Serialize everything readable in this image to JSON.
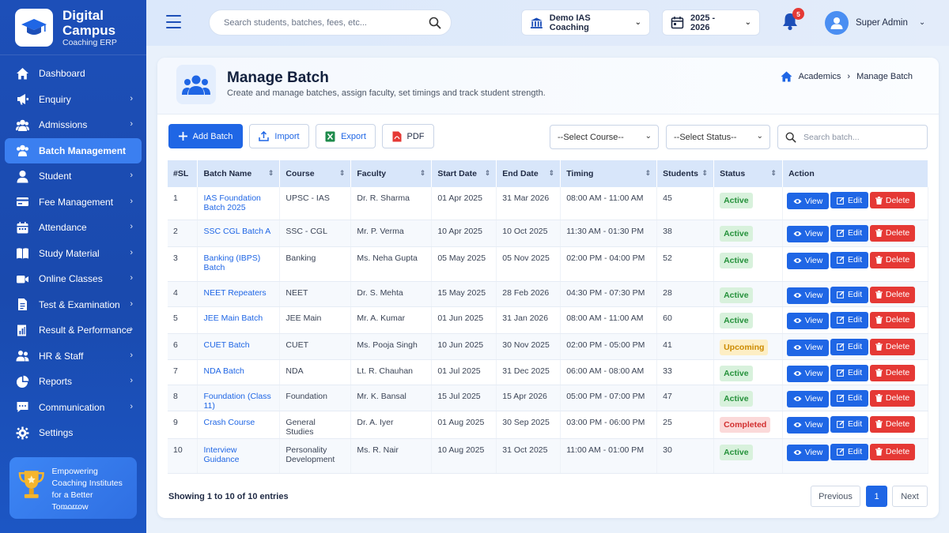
{
  "brand": {
    "title": "Digital Campus",
    "subtitle": "Coaching ERP"
  },
  "sidebar": {
    "items": [
      {
        "label": "Dashboard",
        "icon": "home-icon",
        "chevron": false
      },
      {
        "label": "Enquiry",
        "icon": "megaphone-icon",
        "chevron": true
      },
      {
        "label": "Admissions",
        "icon": "users-icon",
        "chevron": true
      },
      {
        "label": "Batch Management",
        "icon": "batch-icon",
        "chevron": false,
        "active": true
      },
      {
        "label": "Student",
        "icon": "student-icon",
        "chevron": true
      },
      {
        "label": "Fee Management",
        "icon": "card-icon",
        "chevron": true
      },
      {
        "label": "Attendance",
        "icon": "calendar-icon",
        "chevron": true
      },
      {
        "label": "Study Material",
        "icon": "book-icon",
        "chevron": true
      },
      {
        "label": "Online Classes",
        "icon": "video-icon",
        "chevron": true
      },
      {
        "label": "Test & Examination",
        "icon": "document-icon",
        "chevron": true
      },
      {
        "label": "Result & Performance",
        "icon": "chart-icon",
        "chevron": true
      },
      {
        "label": "HR & Staff",
        "icon": "staff-icon",
        "chevron": true
      },
      {
        "label": "Reports",
        "icon": "pie-icon",
        "chevron": true
      },
      {
        "label": "Communication",
        "icon": "chat-icon",
        "chevron": true
      },
      {
        "label": "Settings",
        "icon": "gear-icon",
        "chevron": false
      }
    ],
    "promo": {
      "line1": "Empowering",
      "line2": "Coaching Institutes",
      "line3": "for a Better Tomorrow"
    }
  },
  "topbar": {
    "search_placeholder": "Search students, batches, fees, etc...",
    "institute": "Demo IAS Coaching",
    "session": "2025 - 2026",
    "notifications": "5",
    "user": "Super Admin"
  },
  "page": {
    "title": "Manage Batch",
    "subtitle": "Create and manage batches, assign faculty, set timings and track student strength.",
    "breadcrumb": {
      "parent": "Academics",
      "current": "Manage Batch"
    }
  },
  "toolbar": {
    "add": "Add Batch",
    "import": "Import",
    "export": "Export",
    "pdf": "PDF",
    "course_select": "--Select Course--",
    "status_select": "--Select Status--",
    "search_placeholder": "Search batch..."
  },
  "table": {
    "headers": [
      "#SL",
      "Batch Name",
      "Course",
      "Faculty",
      "Start Date",
      "End Date",
      "Timing",
      "Students",
      "Status",
      "Action"
    ],
    "rows": [
      {
        "sl": "1",
        "name": "IAS Foundation Batch 2025",
        "course": "UPSC - IAS",
        "faculty": "Dr. R. Sharma",
        "start": "01 Apr 2025",
        "end": "31 Mar 2026",
        "timing": "08:00 AM - 11:00 AM",
        "students": "45",
        "status": "Active"
      },
      {
        "sl": "2",
        "name": "SSC CGL Batch A",
        "course": "SSC - CGL",
        "faculty": "Mr. P. Verma",
        "start": "10 Apr 2025",
        "end": "10 Oct 2025",
        "timing": "11:30 AM - 01:30 PM",
        "students": "38",
        "status": "Active"
      },
      {
        "sl": "3",
        "name": "Banking (IBPS) Batch",
        "course": "Banking",
        "faculty": "Ms. Neha Gupta",
        "start": "05 May 2025",
        "end": "05 Nov 2025",
        "timing": "02:00 PM - 04:00 PM",
        "students": "52",
        "status": "Active"
      },
      {
        "sl": "4",
        "name": "NEET Repeaters",
        "course": "NEET",
        "faculty": "Dr. S. Mehta",
        "start": "15 May 2025",
        "end": "28 Feb 2026",
        "timing": "04:30 PM - 07:30 PM",
        "students": "28",
        "status": "Active"
      },
      {
        "sl": "5",
        "name": "JEE Main Batch",
        "course": "JEE Main",
        "faculty": "Mr. A. Kumar",
        "start": "01 Jun 2025",
        "end": "31 Jan 2026",
        "timing": "08:00 AM - 11:00 AM",
        "students": "60",
        "status": "Active"
      },
      {
        "sl": "6",
        "name": "CUET Batch",
        "course": "CUET",
        "faculty": "Ms. Pooja Singh",
        "start": "10 Jun 2025",
        "end": "30 Nov 2025",
        "timing": "02:00 PM - 05:00 PM",
        "students": "41",
        "status": "Upcoming"
      },
      {
        "sl": "7",
        "name": "NDA Batch",
        "course": "NDA",
        "faculty": "Lt. R. Chauhan",
        "start": "01 Jul 2025",
        "end": "31 Dec 2025",
        "timing": "06:00 AM - 08:00 AM",
        "students": "33",
        "status": "Active"
      },
      {
        "sl": "8",
        "name": "Foundation (Class 11)",
        "course": "Foundation",
        "faculty": "Mr. K. Bansal",
        "start": "15 Jul 2025",
        "end": "15 Apr 2026",
        "timing": "05:00 PM - 07:00 PM",
        "students": "47",
        "status": "Active"
      },
      {
        "sl": "9",
        "name": "Crash Course",
        "course": "General Studies",
        "faculty": "Dr. A. Iyer",
        "start": "01 Aug 2025",
        "end": "30 Sep 2025",
        "timing": "03:00 PM - 06:00 PM",
        "students": "25",
        "status": "Completed"
      },
      {
        "sl": "10",
        "name": "Interview Guidance",
        "course": "Personality Development",
        "faculty": "Ms. R. Nair",
        "start": "10 Aug 2025",
        "end": "31 Oct 2025",
        "timing": "11:00 AM - 01:00 PM",
        "students": "30",
        "status": "Active"
      }
    ],
    "actions": {
      "view": "View",
      "edit": "Edit",
      "delete": "Delete"
    }
  },
  "footer": {
    "showing": "Showing 1 to 10 of 10 entries",
    "previous": "Previous",
    "page": "1",
    "next": "Next"
  },
  "colors": {
    "primary": "#1f66e5",
    "sidebar": "#1d4fb8",
    "danger": "#e53935",
    "success": "#25913b",
    "warning": "#cc8a00"
  }
}
